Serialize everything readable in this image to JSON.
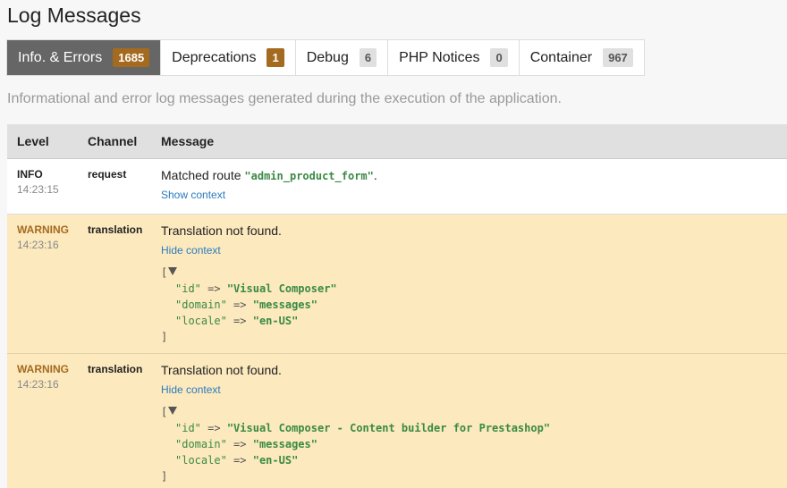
{
  "page": {
    "title": "Log Messages"
  },
  "tabs": [
    {
      "label": "Info. & Errors",
      "count": "1685",
      "active": true
    },
    {
      "label": "Deprecations",
      "count": "1"
    },
    {
      "label": "Debug",
      "count": "6"
    },
    {
      "label": "PHP Notices",
      "count": "0"
    },
    {
      "label": "Container",
      "count": "967"
    }
  ],
  "description": "Informational and error log messages generated during the execution of the application.",
  "table": {
    "headers": {
      "level": "Level",
      "channel": "Channel",
      "message": "Message"
    },
    "rows": [
      {
        "level": "INFO",
        "time": "14:23:15",
        "channel": "request",
        "message_prefix": "Matched route ",
        "message_code": "\"admin_product_form\"",
        "message_suffix": ".",
        "context_link": "Show context"
      },
      {
        "level": "WARNING",
        "time": "14:23:16",
        "channel": "translation",
        "message": "Translation not found.",
        "context_link": "Hide context",
        "context": {
          "open": "[",
          "close": "]",
          "lines": [
            {
              "key": "\"id\"",
              "arrow": "=>",
              "value": "\"Visual Composer\""
            },
            {
              "key": "\"domain\"",
              "arrow": "=>",
              "value": "\"messages\""
            },
            {
              "key": "\"locale\"",
              "arrow": "=>",
              "value": "\"en-US\""
            }
          ]
        }
      },
      {
        "level": "WARNING",
        "time": "14:23:16",
        "channel": "translation",
        "message": "Translation not found.",
        "context_link": "Hide context",
        "context": {
          "open": "[",
          "close": "]",
          "lines": [
            {
              "key": "\"id\"",
              "arrow": "=>",
              "value": "\"Visual Composer - Content builder for Prestashop\""
            },
            {
              "key": "\"domain\"",
              "arrow": "=>",
              "value": "\"messages\""
            },
            {
              "key": "\"locale\"",
              "arrow": "=>",
              "value": "\"en-US\""
            }
          ]
        }
      }
    ]
  }
}
